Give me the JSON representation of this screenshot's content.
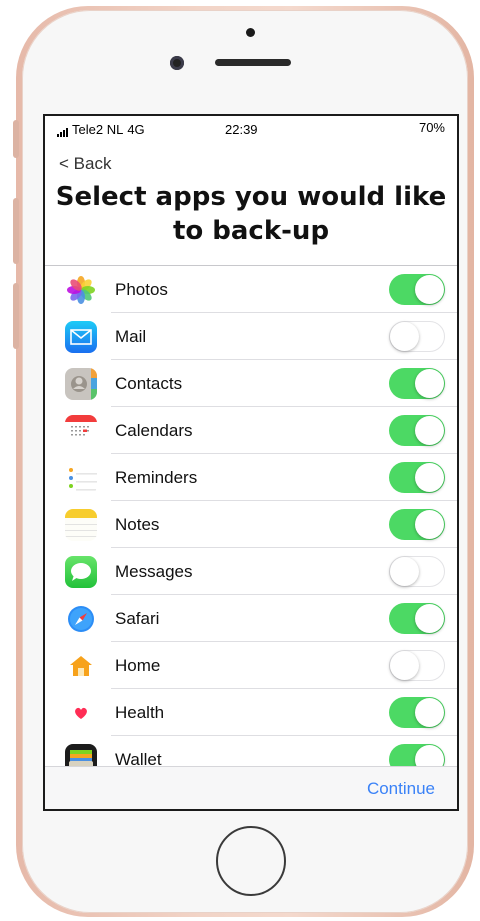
{
  "status_bar": {
    "carrier": "Tele2 NL",
    "network": "4G",
    "time": "22:39",
    "battery": "70%"
  },
  "nav": {
    "back_label": "< Back"
  },
  "page": {
    "title": "Select apps you would like to back-up"
  },
  "apps": [
    {
      "label": "Photos",
      "icon": "photos-icon",
      "enabled": true
    },
    {
      "label": "Mail",
      "icon": "mail-icon",
      "enabled": false
    },
    {
      "label": "Contacts",
      "icon": "contacts-icon",
      "enabled": true
    },
    {
      "label": "Calendars",
      "icon": "calendar-icon",
      "enabled": true
    },
    {
      "label": "Reminders",
      "icon": "reminders-icon",
      "enabled": true
    },
    {
      "label": "Notes",
      "icon": "notes-icon",
      "enabled": true
    },
    {
      "label": "Messages",
      "icon": "messages-icon",
      "enabled": false
    },
    {
      "label": "Safari",
      "icon": "safari-icon",
      "enabled": true
    },
    {
      "label": "Home",
      "icon": "home-icon",
      "enabled": false
    },
    {
      "label": "Health",
      "icon": "health-icon",
      "enabled": true
    },
    {
      "label": "Wallet",
      "icon": "wallet-icon",
      "enabled": true
    }
  ],
  "footer": {
    "continue_label": "Continue"
  },
  "colors": {
    "toggle_on": "#4cd964",
    "link": "#3a82f7"
  }
}
